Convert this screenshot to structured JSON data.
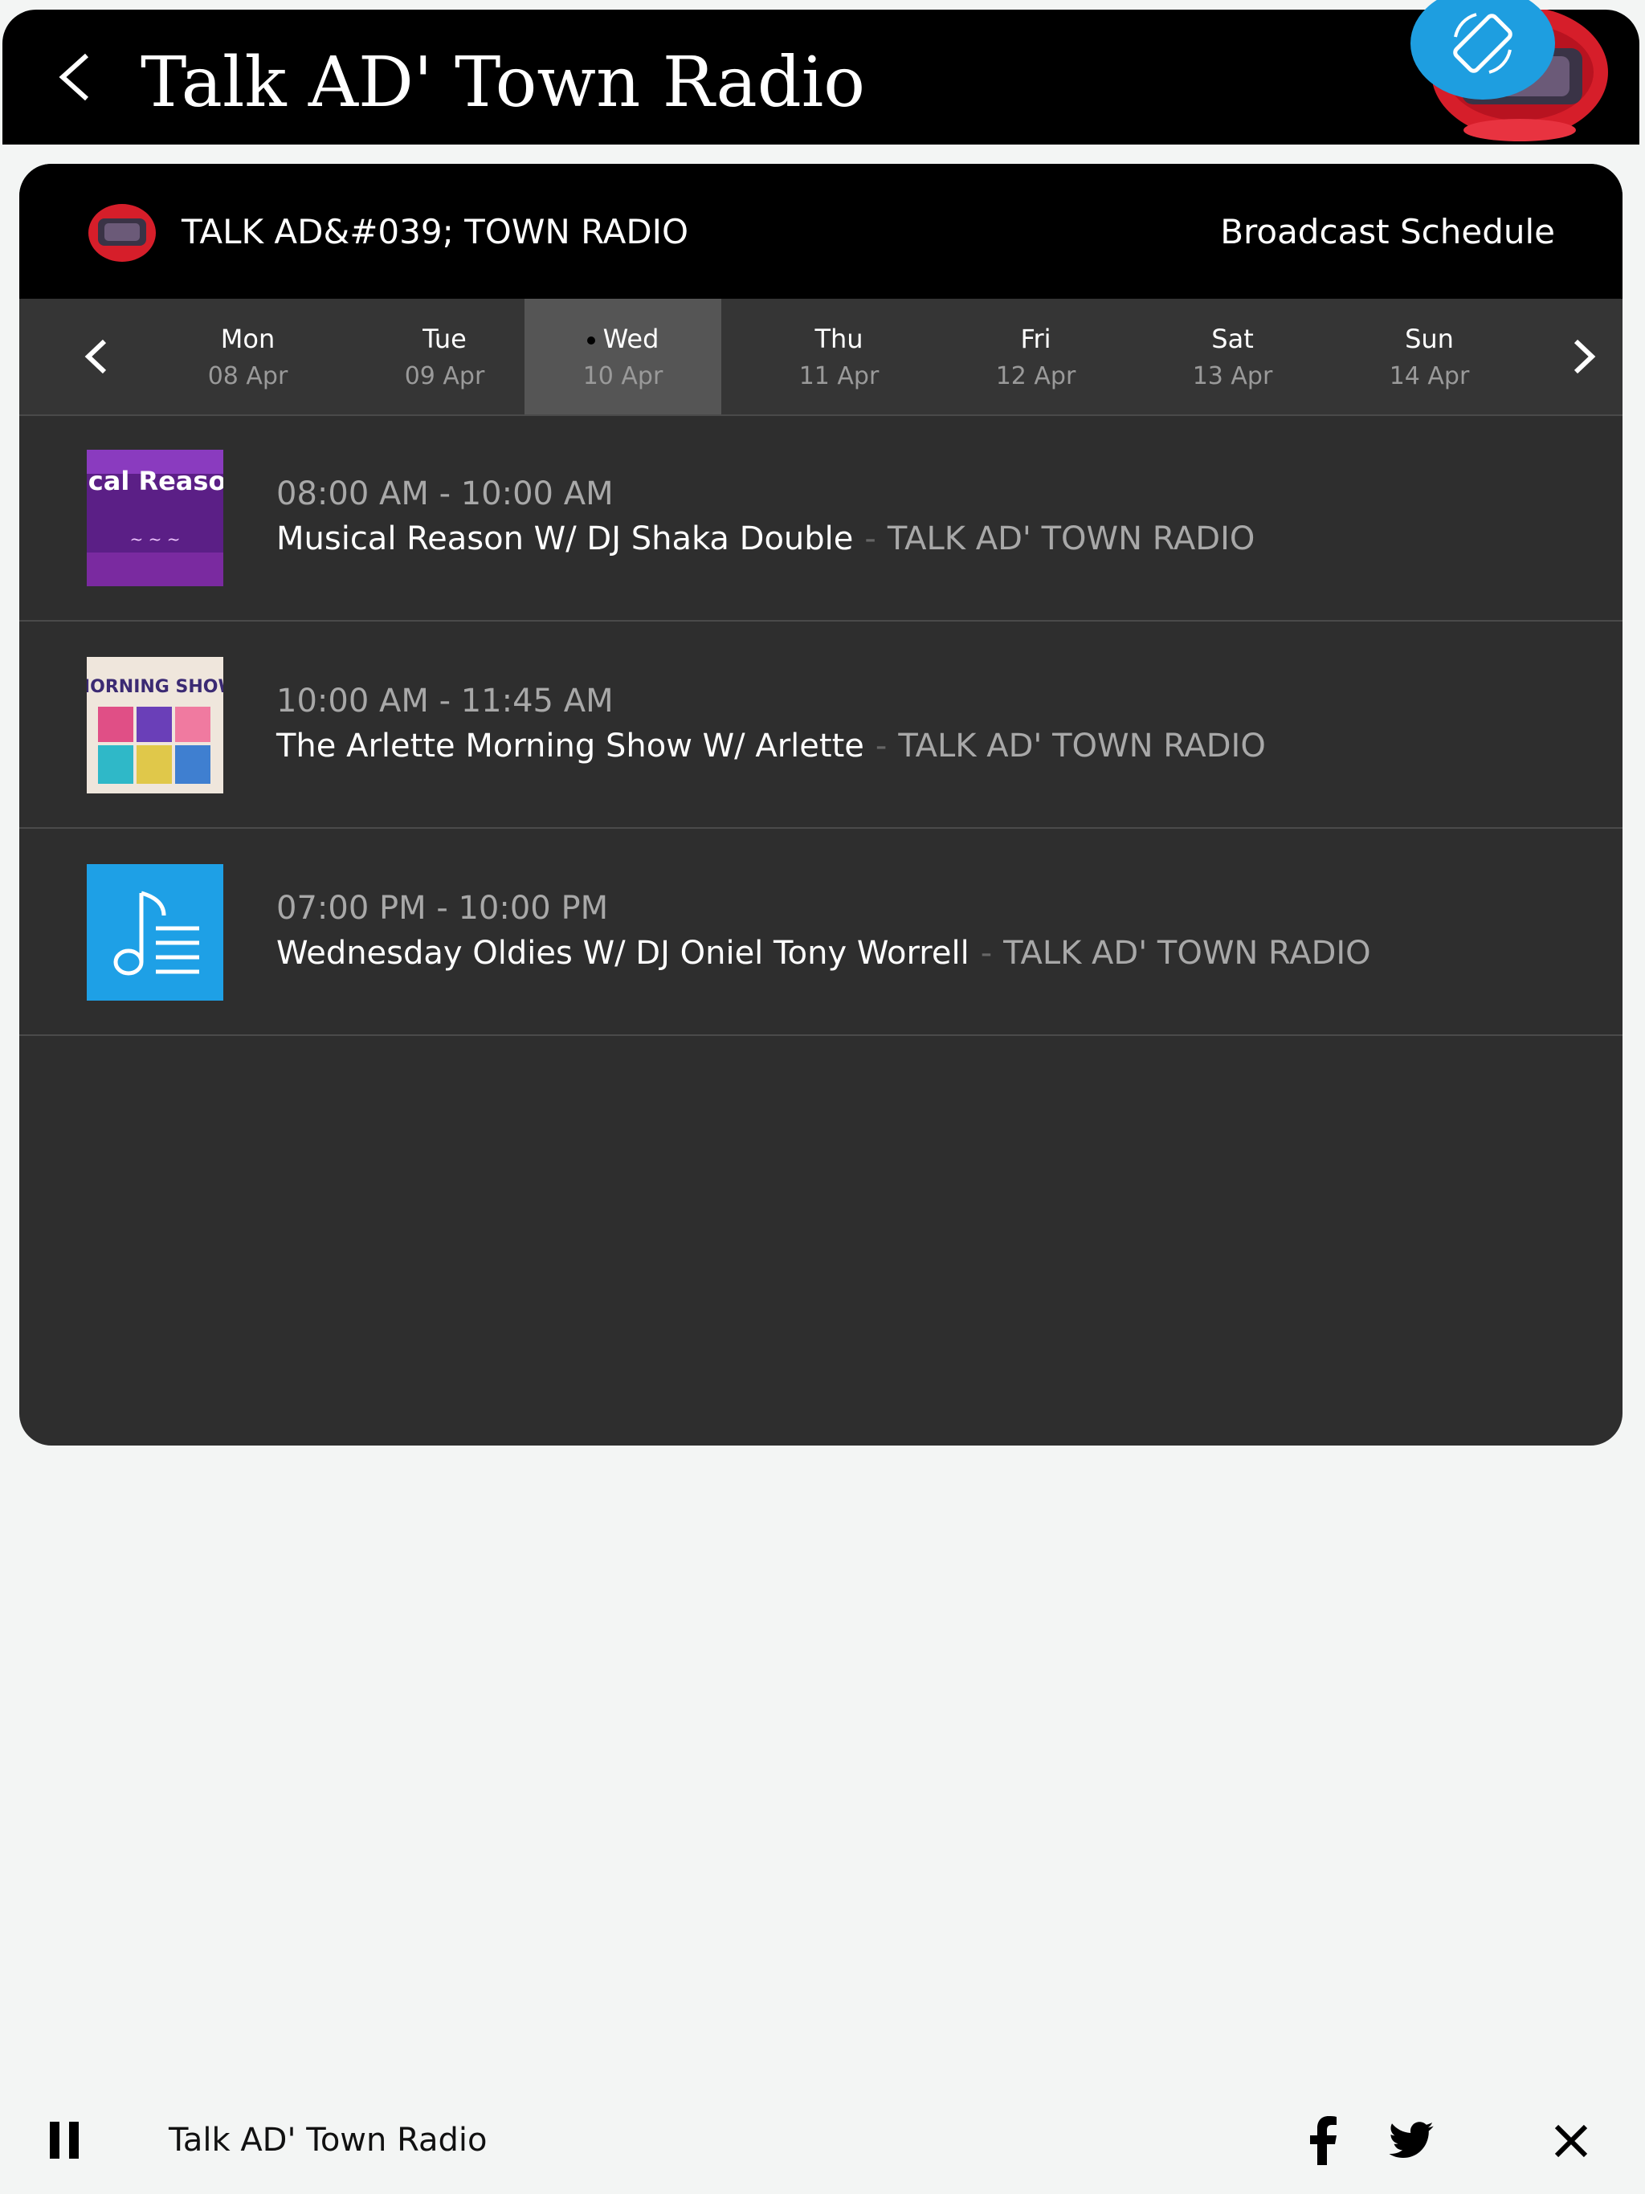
{
  "header": {
    "title": "Talk AD' Town Radio"
  },
  "schedule": {
    "station_name": "TALK AD&#039; TOWN RADIO",
    "title": "Broadcast Schedule",
    "days": [
      {
        "name": "Mon",
        "date": "08 Apr"
      },
      {
        "name": "Tue",
        "date": "09 Apr"
      },
      {
        "name": "Wed",
        "date": "10 Apr"
      },
      {
        "name": "Thu",
        "date": "11 Apr"
      },
      {
        "name": "Fri",
        "date": "12 Apr"
      },
      {
        "name": "Sat",
        "date": "13 Apr"
      },
      {
        "name": "Sun",
        "date": "14 Apr"
      }
    ],
    "selected_day": "Wed",
    "shows": [
      {
        "time": "08:00 AM - 10:00 AM",
        "name": "Musical Reason W/ DJ Shaka Double",
        "separator": "-",
        "station": "TALK AD' TOWN RADIO",
        "art_text": "Musical Reasoning"
      },
      {
        "time": "10:00 AM - 11:45 AM",
        "name": "The Arlette Morning Show W/ Arlette",
        "separator": "-",
        "station": "TALK AD' TOWN RADIO",
        "art_text": "MORNING SHOW"
      },
      {
        "time": "07:00 PM - 10:00 PM",
        "name": "Wednesday Oldies W/ DJ Oniel Tony Worrell",
        "separator": "-",
        "station": "TALK AD' TOWN RADIO",
        "art_text": ""
      }
    ]
  },
  "player": {
    "title": "Talk AD' Town Radio"
  },
  "colors": {
    "accent": "#1e9ee0",
    "panel": "#2e2e2e",
    "header": "#000000"
  }
}
